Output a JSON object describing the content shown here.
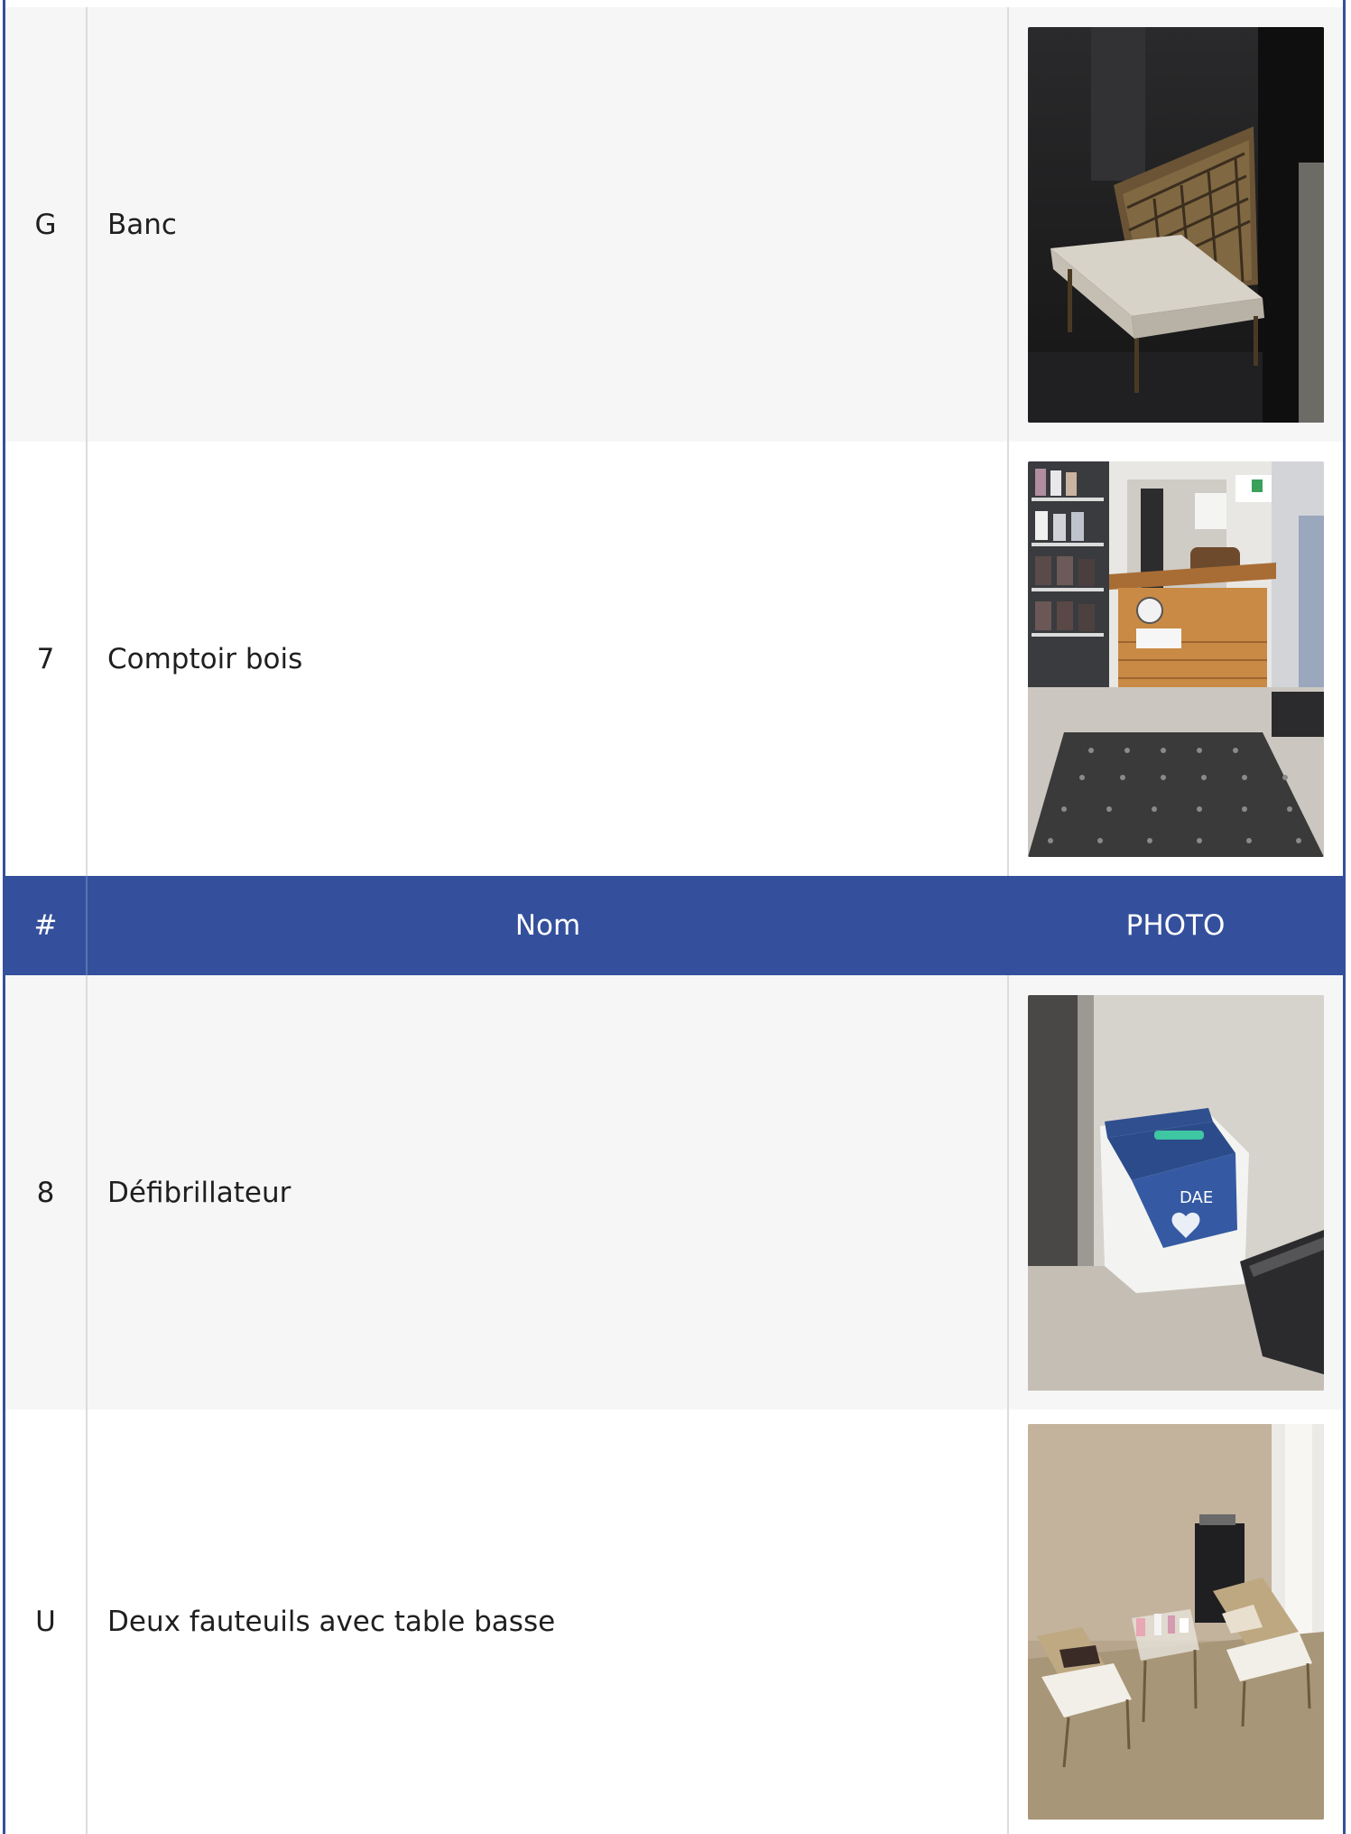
{
  "table": {
    "header": {
      "num": "#",
      "name": "Nom",
      "photo": "PHOTO"
    },
    "rows_top": [
      {
        "num": "G",
        "name": "Banc",
        "photo_icon": "bench-photo"
      },
      {
        "num": "7",
        "name": "Comptoir bois",
        "photo_icon": "wooden-counter-photo"
      }
    ],
    "rows_bottom": [
      {
        "num": "8",
        "name": "Défibrillateur",
        "photo_icon": "defibrillator-photo"
      },
      {
        "num": "U",
        "name": "Deux fauteuils avec table basse",
        "photo_icon": "armchairs-photo"
      }
    ]
  },
  "photo_labels": {
    "defibrillator_box": "DAE"
  },
  "colors": {
    "header_bg": "#34509c",
    "header_text": "#ffffff",
    "row_shade": "#f6f6f6",
    "row_plain": "#ffffff",
    "divider": "#dcdcdc"
  }
}
